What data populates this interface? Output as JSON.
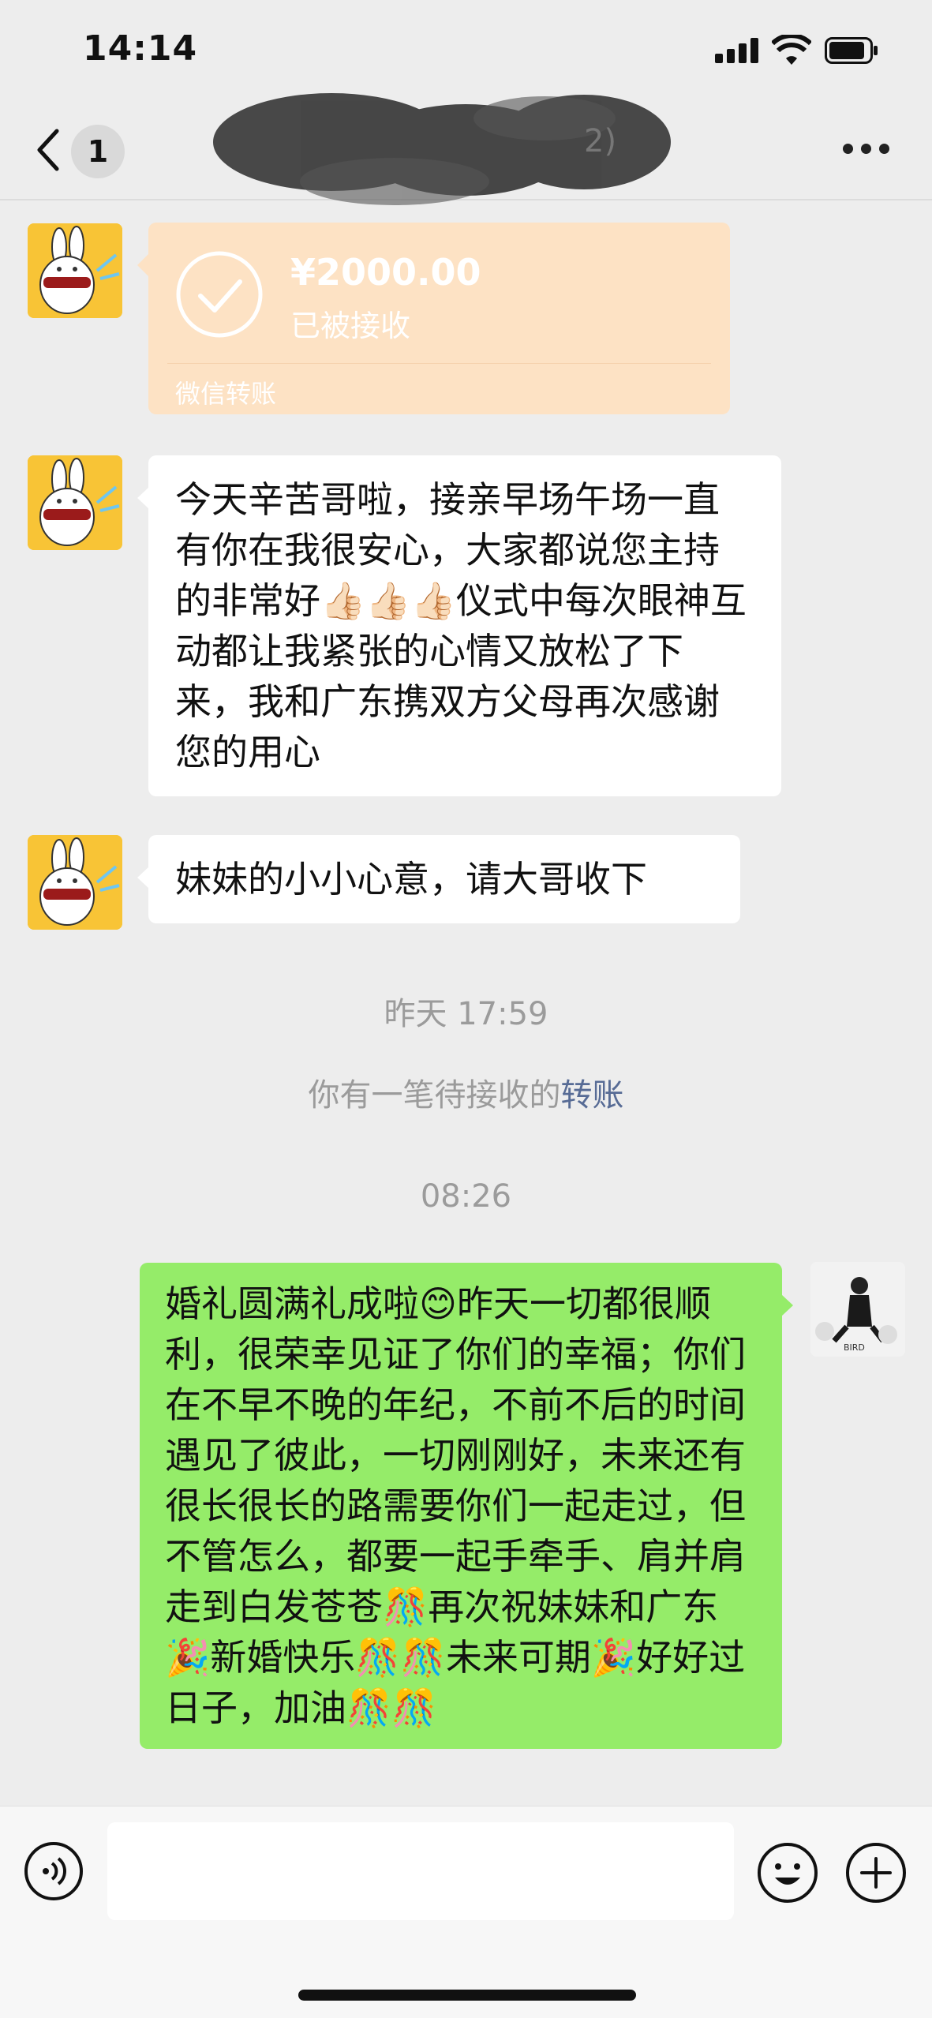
{
  "status_bar": {
    "time": "14:14"
  },
  "nav": {
    "unread_count": "1",
    "title_visible": "2)"
  },
  "messages": {
    "transfer": {
      "amount": "¥2000.00",
      "status": "已被接收",
      "footer": "微信转账"
    },
    "msg1": "今天辛苦哥啦，接亲早场午场一直有你在我很安心，大家都说您主持的非常好👍🏻👍🏻👍🏻仪式中每次眼神互动都让我紧张的心情又放松了下来，我和广东携双方父母再次感谢您的用心",
    "msg2": "妹妹的小小心意，请大哥收下",
    "timestamp1": "昨天 17:59",
    "system_notice": {
      "prefix": "你有一笔待接收的",
      "link": "转账"
    },
    "timestamp2": "08:26",
    "msg3": "婚礼圆满礼成啦😊昨天一切都很顺利，很荣幸见证了你们的幸福；你们在不早不晚的年纪，不前不后的时间遇见了彼此，一切刚刚好，未来还有很长很长的路需要你们一起走过，但不管怎么，都要一起手牵手、肩并肩走到白发苍苍🎊再次祝妹妹和广东🎉新婚快乐🎊🎊未来可期🎉好好过日子，加油🎊🎊",
    "self_avatar_text": "BIRD"
  },
  "colors": {
    "background": "#ededed",
    "incoming_bubble": "#ffffff",
    "outgoing_bubble": "#95ec69",
    "transfer_card": "#fde2c4",
    "link": "#576b95"
  },
  "icons": {
    "back": "chevron-left-icon",
    "more": "more-dots-icon",
    "voice": "voice-icon",
    "emoji": "emoji-icon",
    "plus": "plus-icon",
    "transfer_check": "check-circle-icon"
  }
}
